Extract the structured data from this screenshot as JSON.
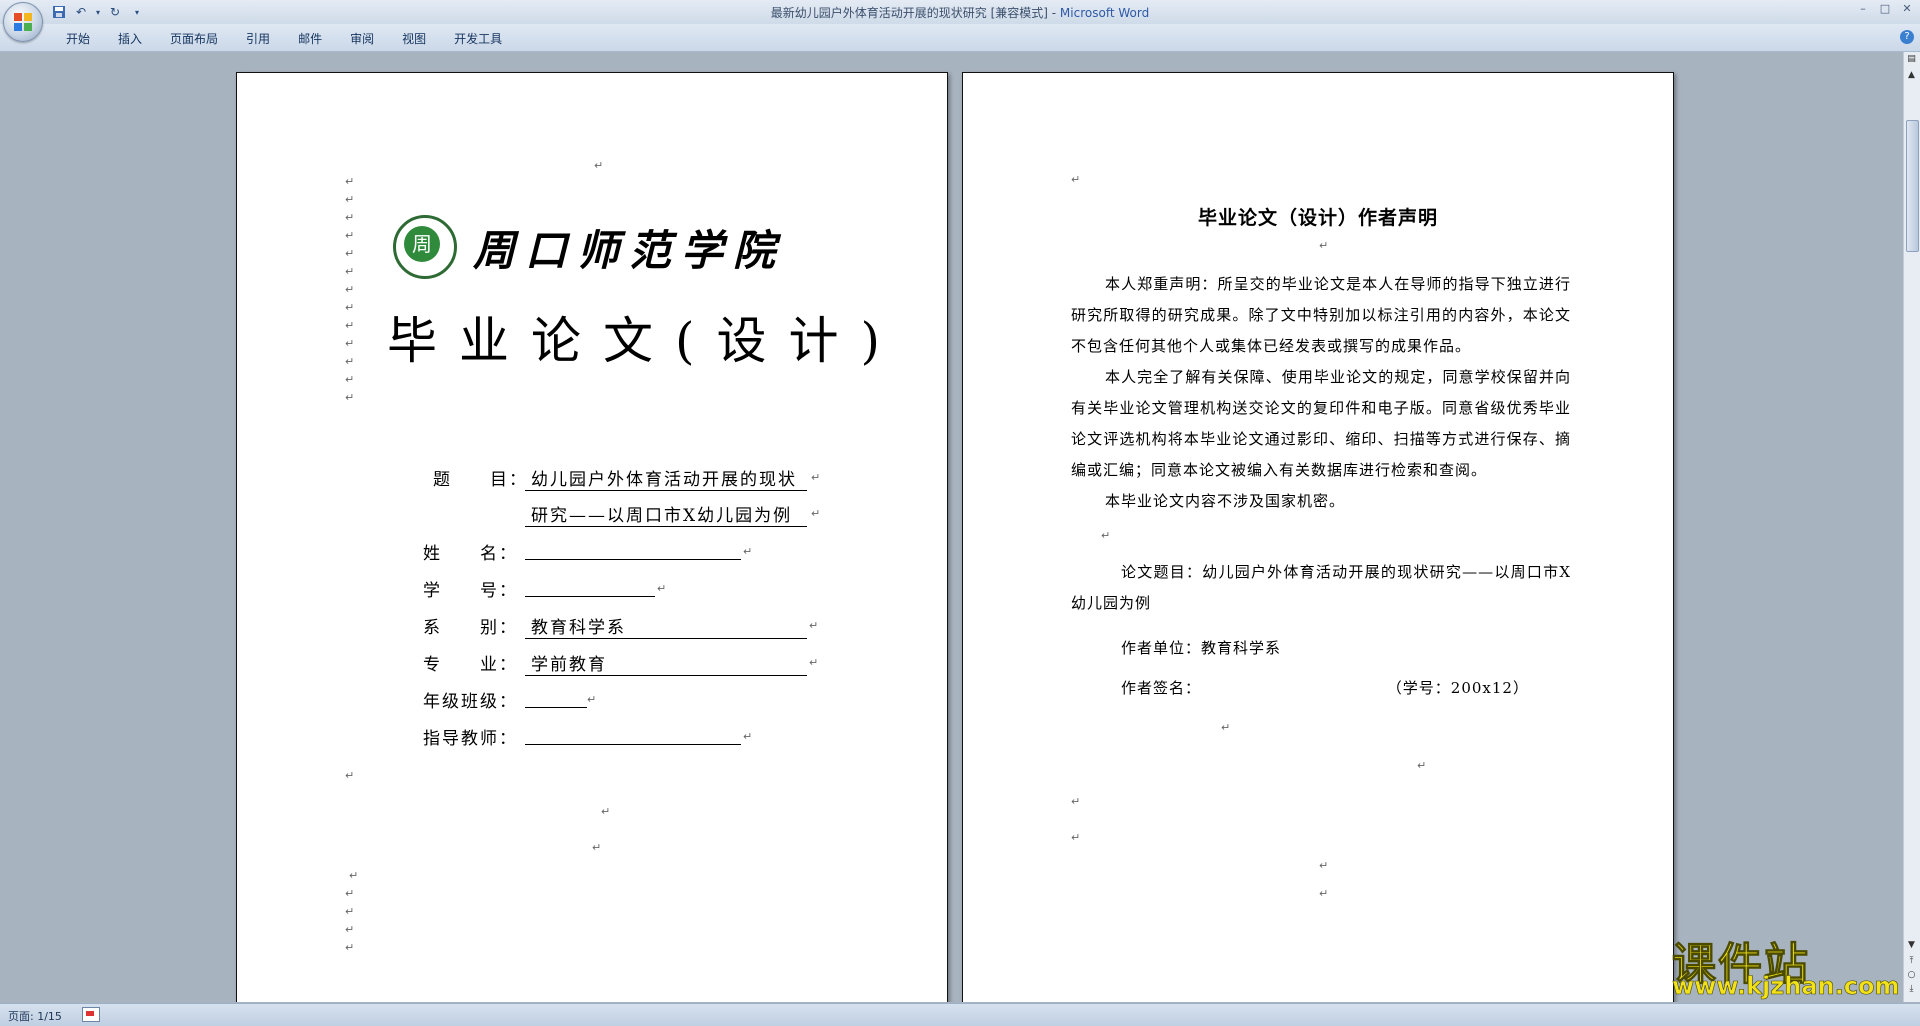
{
  "window": {
    "title": "最新幼儿园户外体育活动开展的现状研究 [兼容模式] - ",
    "app_name": "Microsoft Word",
    "minimize": "–",
    "maximize": "□",
    "close": "✕"
  },
  "quick_access": {
    "save_icon": "save-icon",
    "undo_icon": "undo-icon",
    "redo_icon": "redo-icon",
    "customize_icon": "dropdown-icon"
  },
  "ribbon": {
    "tabs": [
      "开始",
      "插入",
      "页面布局",
      "引用",
      "邮件",
      "审阅",
      "视图",
      "开发工具"
    ],
    "help": "?"
  },
  "page1": {
    "college_name": "周口师范学院",
    "seal_char": "周",
    "thesis_title": "毕业论文(设计)",
    "topic_label": "题　　目：",
    "topic_line1": "幼儿园户外体育活动开展的现状",
    "topic_line2": "研究——以周口市X幼儿园为例",
    "name_label": "姓　　名：",
    "name_value": "",
    "id_label": "学　　号：",
    "id_value": "",
    "dept_label": "系　　别：",
    "dept_value": "教育科学系",
    "major_label": "专　　业：",
    "major_value": "学前教育",
    "class_label": "年级班级：",
    "class_value": "",
    "advisor_label": "指导教师：",
    "advisor_value": ""
  },
  "page2": {
    "title": "毕业论文（设计）作者声明",
    "para1": "本人郑重声明：所呈交的毕业论文是本人在导师的指导下独立进行研究所取得的研究成果。除了文中特别加以标注引用的内容外，本论文不包含任何其他个人或集体已经发表或撰写的成果作品。",
    "para2": "本人完全了解有关保障、使用毕业论文的规定，同意学校保留并向有关毕业论文管理机构送交论文的复印件和电子版。同意省级优秀毕业论文评选机构将本毕业论文通过影印、缩印、扫描等方式进行保存、摘编或汇编；同意本论文被编入有关数据库进行检索和查阅。",
    "para3": "本毕业论文内容不涉及国家机密。",
    "thesis_topic": "论文题目：幼儿园户外体育活动开展的现状研究——以周口市X幼儿园为例",
    "author_unit": "作者单位：教育科学系",
    "author_sign": "作者签名：",
    "student_no": "（学号：200x12）"
  },
  "paragraph_mark": "↵",
  "status": {
    "page": "页面: 1/15"
  },
  "watermark": {
    "line1": "课件站",
    "line2": "www.kjzhan.com"
  }
}
